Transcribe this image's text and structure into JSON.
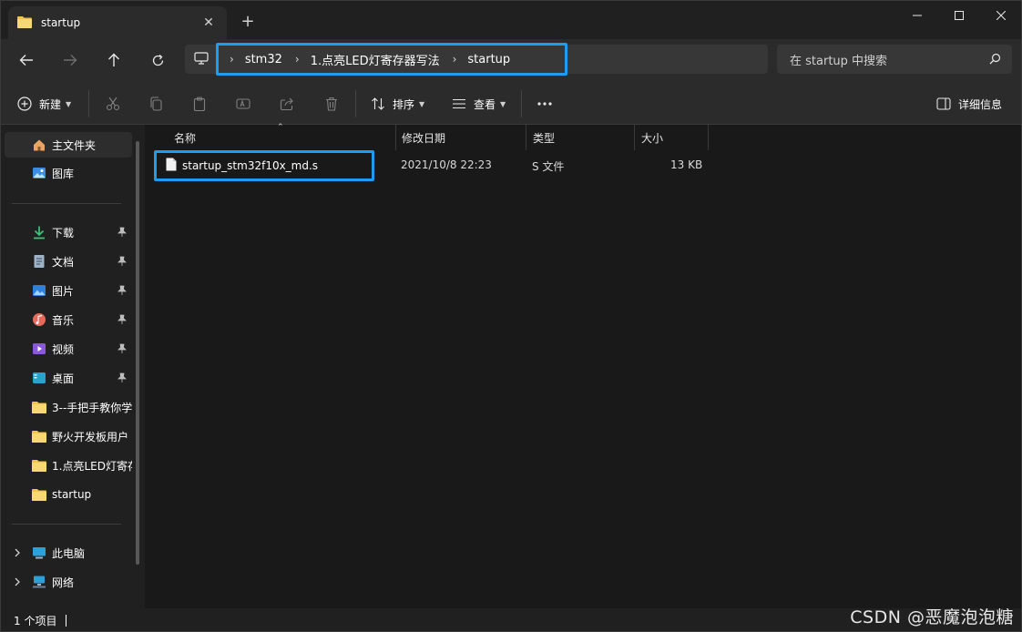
{
  "tab": {
    "title": "startup"
  },
  "breadcrumbs": [
    "stm32",
    "1.点亮LED灯寄存器写法",
    "startup"
  ],
  "search": {
    "placeholder": "在 startup 中搜索"
  },
  "toolbar": {
    "new_label": "新建",
    "sort_label": "排序",
    "view_label": "查看",
    "details_label": "详细信息"
  },
  "sidebar": {
    "home": "主文件夹",
    "gallery": "图库",
    "downloads": "下载",
    "documents": "文档",
    "pictures": "图片",
    "music": "音乐",
    "videos": "视频",
    "desktop": "桌面",
    "folder1": "3--手把手教你学",
    "folder2": "野火开发板用户",
    "folder3": "1.点亮LED灯寄存",
    "folder4": "startup",
    "thispc": "此电脑",
    "network": "网络"
  },
  "columns": {
    "name": "名称",
    "date": "修改日期",
    "type": "类型",
    "size": "大小"
  },
  "files": [
    {
      "name": "startup_stm32f10x_md.s",
      "date": "2021/10/8 22:23",
      "type": "S 文件",
      "size": "13 KB"
    }
  ],
  "status": {
    "count": "1 个项目"
  },
  "watermark": "CSDN @恶魔泡泡糖",
  "colors": {
    "accent": "#1e9cf0",
    "folder": "#f2c14e"
  }
}
